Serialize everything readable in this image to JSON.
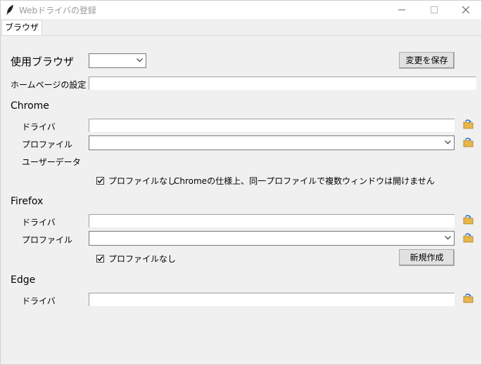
{
  "window": {
    "title": "Webドライバの登録",
    "minimize_glyph": "—",
    "icon": "feather-icon"
  },
  "tabs": [
    {
      "label": "ブラウザ",
      "active": true
    }
  ],
  "browser_select": {
    "label": "使用ブラウザ",
    "value": ""
  },
  "save_button": {
    "label": "変更を保存"
  },
  "homepage": {
    "label": "ホームページの設定",
    "value": ""
  },
  "chrome": {
    "section_label": "Chrome",
    "driver_label": "ドライバ",
    "driver_value": "",
    "profile_label": "プロファイル",
    "profile_value": "",
    "userdata_label": "ユーザーデータ",
    "no_profile_label": "プロファイルなし",
    "no_profile_checked": true,
    "note": "Chromeの仕様上、同一プロファイルで複数ウィンドウは開けません"
  },
  "firefox": {
    "section_label": "Firefox",
    "driver_label": "ドライバ",
    "driver_value": "",
    "profile_label": "プロファイル",
    "profile_value": "",
    "no_profile_label": "プロファイルなし",
    "no_profile_checked": true,
    "new_button_label": "新規作成"
  },
  "edge": {
    "section_label": "Edge",
    "driver_label": "ドライバ",
    "driver_value": ""
  },
  "colors": {
    "window_bg": "#f0f0f0",
    "title_text": "#9a9a9a",
    "folder_icon": "#e8b74a",
    "folder_arrow": "#2a6fc9"
  }
}
